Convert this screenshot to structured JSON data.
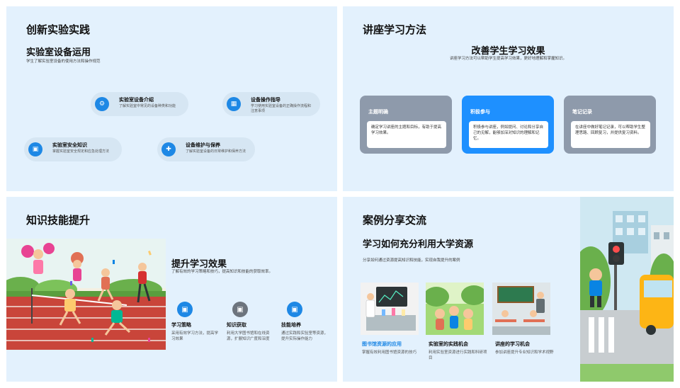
{
  "slide1": {
    "title": "创新实验实践",
    "subtitle": "实验室设备运用",
    "desc": "学生了解实验室设备的使用方法和操作规范",
    "items": [
      {
        "title": "实验室设备介绍",
        "desc": "了解实验室中常见的设备种类和功能",
        "icon": "gear-icon"
      },
      {
        "title": "设备操作指导",
        "desc": "学习使用实验室设备的正确操作流程和注意事项",
        "icon": "keyboard-icon"
      },
      {
        "title": "实验室安全知识",
        "desc": "掌握实验室安全规定和应急处理方法",
        "icon": "image-icon"
      },
      {
        "title": "设备维护与保养",
        "desc": "了解实验室设备的日常维护和保养方法",
        "icon": "tools-icon"
      }
    ]
  },
  "slide2": {
    "title": "讲座学习方法",
    "subtitle": "改善学生学习效果",
    "desc": "讲座学习方法可以帮助学生提高学习效果，更好地理解和掌握知识。",
    "cards": [
      {
        "title": "主题明确",
        "text": "确定学习讲座的主题和目标，有助于提高学习效果。",
        "active": false
      },
      {
        "title": "积极参与",
        "text": "积极参与讲座，例如提问、讨论和分享自己的见解，能够加深对知识的理解和记忆。",
        "active": true
      },
      {
        "title": "笔记记录",
        "text": "在讲座中做好笔记记录，可以帮助学生整理思路、回顾复习，并提供复习资料。",
        "active": false
      }
    ]
  },
  "slide3": {
    "title": "知识技能提升",
    "subtitle": "提升学习效果",
    "desc": "了解有效的学习策略和技巧，提高知识和技能的获取效率。",
    "features": [
      {
        "title": "学习策略",
        "desc": "采用有效学习方法，提高学习效果"
      },
      {
        "title": "知识获取",
        "desc": "利用大学图书馆和在线资源，扩展知识广度和深度"
      },
      {
        "title": "技能培养",
        "desc": "通过实践和实验室等资源，提升实际操作能力"
      }
    ]
  },
  "slide4": {
    "title": "案例分享交流",
    "subtitle": "学习如何充分利用大学资源",
    "desc": "分享如何通过资源提高知识和技能，实现自我提升的案例",
    "cases": [
      {
        "title": "图书馆资源的应用",
        "desc": "掌握有效利用图书馆资源的技巧"
      },
      {
        "title": "实验室的实践机会",
        "desc": "利用实验室资源进行实践和科研项目"
      },
      {
        "title": "讲座的学习机会",
        "desc": "参加讲座提升专业知识和学术视野"
      }
    ]
  },
  "colors": {
    "accent": "#1e90ff",
    "slide_bg": "#e3f1fd",
    "card_gray": "#8e9aab"
  }
}
